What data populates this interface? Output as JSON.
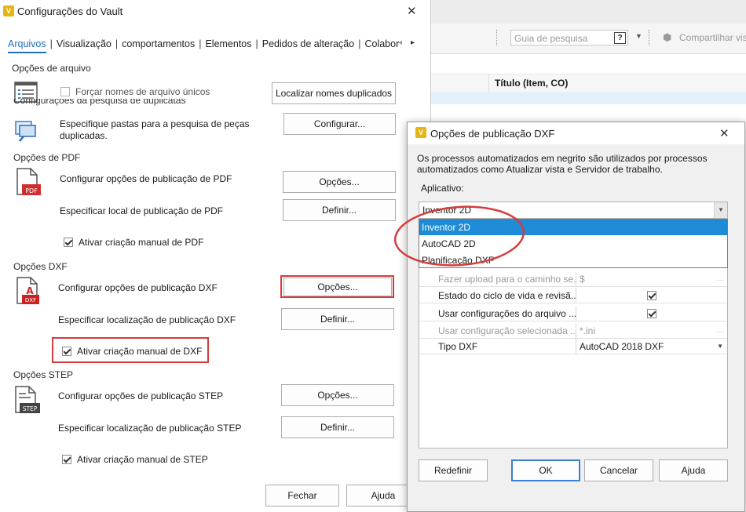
{
  "vault_dialog": {
    "title": "Configurações do Vault",
    "close": "✕",
    "tabs": [
      "Arquivos",
      "Visualização",
      "comportamentos",
      "Elementos",
      "Pedidos de alteração",
      "Colabor"
    ],
    "file_options": {
      "title": "Opções de arquivo",
      "force_unique": "Forçar nomes de arquivo únicos",
      "find_duplicates_button": "Localizar nomes duplicados",
      "dup_search_title": "Configurações da pesquisa de duplicatas",
      "specify_folders": "Especifique pastas para a pesquisa de peças duplicadas.",
      "configure_button": "Configurar..."
    },
    "pdf_options": {
      "title": "Opções de PDF",
      "configure_label": "Configurar opções de publicação de PDF",
      "options_button": "Opções...",
      "location_label": "Especificar local de publicação de PDF",
      "define_button": "Definir...",
      "manual_label": "Ativar criação manual de PDF"
    },
    "dxf_options": {
      "title": "Opções DXF",
      "configure_label": "Configurar opções de publicação DXF",
      "options_button": "Opções...",
      "location_label": "Especificar localização de publicação DXF",
      "define_button": "Definir...",
      "manual_label": "Ativar criação manual de DXF"
    },
    "step_options": {
      "title": "Opções STEP",
      "configure_label": "Configurar opções de publicação STEP",
      "options_button": "Opções...",
      "location_label": "Especificar localização de publicação STEP",
      "define_button": "Definir...",
      "manual_label": "Ativar criação manual de STEP"
    },
    "close_button": "Fechar",
    "help_button": "Ajuda"
  },
  "background_app": {
    "search_placeholder": "Guia de pesquisa",
    "share_label": "Compartilhar vis",
    "column_header": "Título (Item, CO)"
  },
  "dxf_dialog": {
    "title": "Opções de publicação DXF",
    "close": "✕",
    "description": "Os processos automatizados em negrito são utilizados por processos automatizados como Atualizar vista e Servidor de trabalho.",
    "app_label": "Aplicativo:",
    "selected_app": "Inventor 2D",
    "dropdown_options": [
      "Inventor 2D",
      "AutoCAD 2D",
      "Planificação DXF"
    ],
    "grid": [
      {
        "name": "Fazer upload para o caminho se...",
        "value": "$",
        "disabled": true
      },
      {
        "name": "Estado do ciclo de vida e revisã...",
        "value": "checked",
        "disabled": false
      },
      {
        "name": "Usar configurações do arquivo ...",
        "value": "checked",
        "disabled": false
      },
      {
        "name": "Usar configuração selecionada ...",
        "value": "*.ini",
        "disabled": true
      },
      {
        "name": "Tipo DXF",
        "value": "AutoCAD 2018 DXF",
        "disabled": false
      }
    ],
    "reset_button": "Redefinir",
    "ok_button": "OK",
    "cancel_button": "Cancelar",
    "help_button": "Ajuda"
  },
  "colors": {
    "accent": "#1f6fbf",
    "highlight_red": "#d63c3c",
    "selection_blue": "#1e8bd6",
    "vault_yellow": "#e8b40f"
  }
}
